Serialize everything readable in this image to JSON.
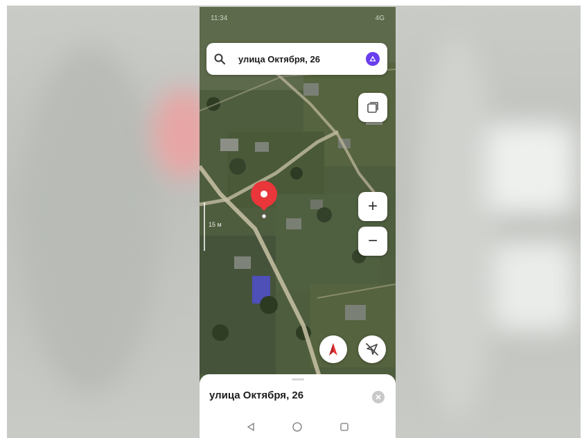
{
  "status_bar": {
    "time": "11:34",
    "right": "4G"
  },
  "search": {
    "query": "улица Октября, 26",
    "icon": "search-icon",
    "assistant_icon": "alice-icon"
  },
  "map": {
    "scale_label": "15 м",
    "pin_color": "#e8363a"
  },
  "controls": {
    "layers_icon": "layers-icon",
    "zoom_in_label": "+",
    "zoom_out_label": "−",
    "compass_icon": "compass-icon",
    "location_icon": "location-off-icon"
  },
  "sheet": {
    "address": "улица Октября, 26",
    "close_icon": "close-icon"
  },
  "navbar": {
    "back": "back-icon",
    "home": "home-icon",
    "recents": "recents-icon"
  },
  "colors": {
    "accent": "#6a3df0",
    "pin": "#e8363a"
  }
}
